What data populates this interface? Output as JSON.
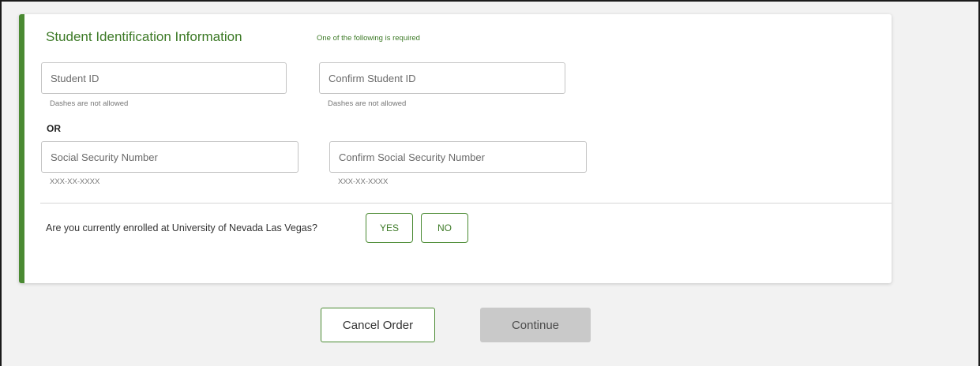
{
  "card": {
    "title": "Student Identification Information",
    "subtitle": "One of the following is required",
    "student_id": {
      "value": "",
      "placeholder": "Student ID",
      "hint": "Dashes are not allowed"
    },
    "confirm_student_id": {
      "value": "",
      "placeholder": "Confirm Student ID",
      "hint": "Dashes are not allowed"
    },
    "or_label": "OR",
    "ssn": {
      "value": "",
      "placeholder": "Social Security Number",
      "hint": "XXX-XX-XXXX"
    },
    "confirm_ssn": {
      "value": "",
      "placeholder": "Confirm Social Security Number",
      "hint": "XXX-XX-XXXX"
    },
    "enrollment": {
      "question": "Are you currently enrolled at University of Nevada Las Vegas?",
      "yes_label": "YES",
      "no_label": "NO"
    }
  },
  "actions": {
    "cancel_label": "Cancel Order",
    "continue_label": "Continue",
    "continue_enabled": false
  },
  "colors": {
    "accent": "#4a8a32",
    "disabled_button": "#c9c9c9"
  }
}
